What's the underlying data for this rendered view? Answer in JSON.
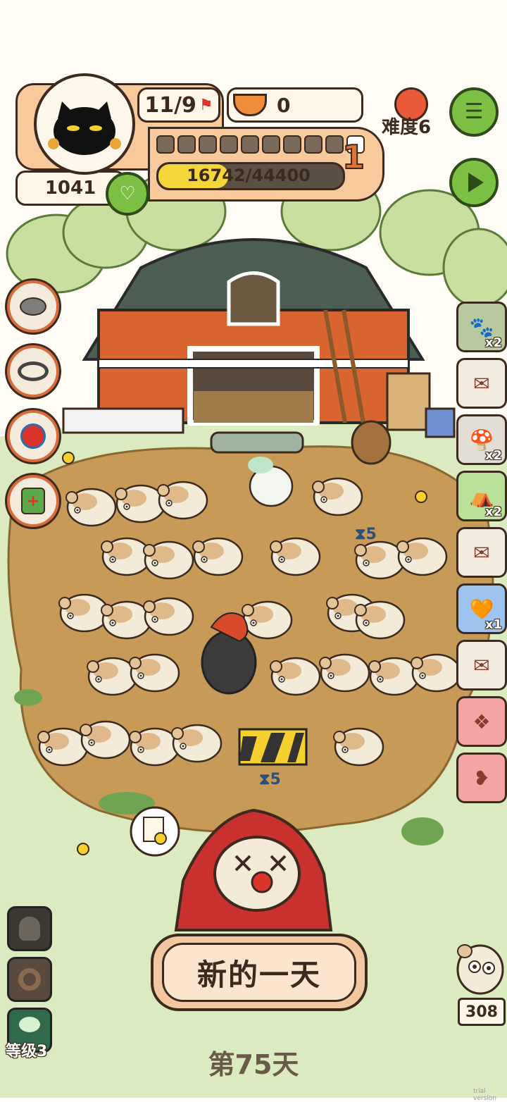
{
  "profile": {
    "day_progress": "11/9",
    "coins": "0",
    "hearts": "1041",
    "level_number": "1",
    "xp_text": "16742/44400",
    "xp_fraction": 0.377,
    "segments_filled": 1,
    "segments_total": 10
  },
  "difficulty": {
    "label": "难度6"
  },
  "inventory": [
    {
      "name": "paw-card",
      "count": "x2",
      "bg": "#b9c99e"
    },
    {
      "name": "envelope",
      "count": "",
      "bg": "#f3ece1"
    },
    {
      "name": "mushroom",
      "count": "x2",
      "bg": "#e2ded6"
    },
    {
      "name": "tent",
      "count": "x2",
      "bg": "#b9e19a"
    },
    {
      "name": "envelope",
      "count": "",
      "bg": "#f3ece1"
    },
    {
      "name": "orange-bag",
      "count": "x1",
      "bg": "#9cc4ee"
    },
    {
      "name": "envelope",
      "count": "",
      "bg": "#f3ece1"
    },
    {
      "name": "ornament",
      "count": "",
      "bg": "#f5a4a4"
    },
    {
      "name": "rat-gift",
      "count": "",
      "bg": "#f5a4a4"
    }
  ],
  "timers": {
    "top": "5",
    "bottom": "5"
  },
  "new_day_label": "新的一天",
  "day_label": "第75天",
  "level_label": "等级3",
  "rat_count": "308",
  "watermark": "trial version",
  "colors": {
    "accent": "#f7c99b",
    "green": "#7cc043",
    "dark": "#3b2a1d"
  }
}
